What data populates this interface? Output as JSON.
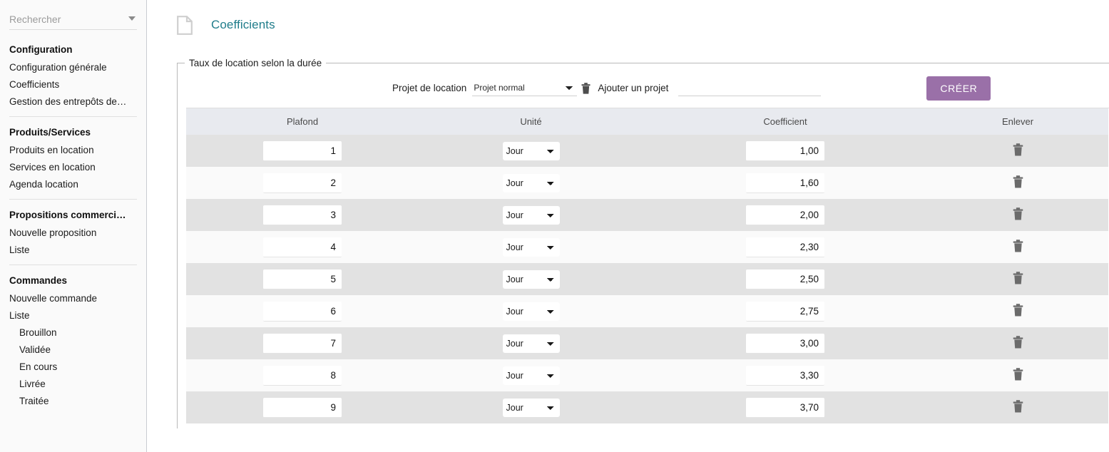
{
  "sidebar": {
    "search": {
      "placeholder": "Rechercher",
      "value": ""
    },
    "groups": [
      {
        "title": "Configuration",
        "items": [
          {
            "label": "Configuration générale",
            "sub": false
          },
          {
            "label": "Coefficients",
            "sub": false
          },
          {
            "label": "Gestion des entrepôts de…",
            "sub": false
          }
        ]
      },
      {
        "title": "Produits/Services",
        "items": [
          {
            "label": "Produits en location",
            "sub": false
          },
          {
            "label": "Services en location",
            "sub": false
          },
          {
            "label": "Agenda location",
            "sub": false
          }
        ]
      },
      {
        "title": "Propositions commerci…",
        "items": [
          {
            "label": "Nouvelle proposition",
            "sub": false
          },
          {
            "label": "Liste",
            "sub": false
          }
        ]
      },
      {
        "title": "Commandes",
        "items": [
          {
            "label": "Nouvelle commande",
            "sub": false
          },
          {
            "label": "Liste",
            "sub": false
          },
          {
            "label": "Brouillon",
            "sub": true
          },
          {
            "label": "Validée",
            "sub": true
          },
          {
            "label": "En cours",
            "sub": true
          },
          {
            "label": "Livrée",
            "sub": true
          },
          {
            "label": "Traitée",
            "sub": true
          }
        ]
      }
    ]
  },
  "header": {
    "icon": "document-icon",
    "title": "Coefficients",
    "title_color": "#217d8b"
  },
  "panel": {
    "legend": "Taux de location selon la durée",
    "project_label": "Projet de location",
    "project_selected": "Projet normal",
    "project_options": [
      "Projet normal"
    ],
    "delete_project_icon": "trash-icon",
    "add_label": "Ajouter un projet",
    "add_placeholder": "",
    "add_value": "",
    "create_label": "CRÉER",
    "create_color": "#9a70a8"
  },
  "table": {
    "columns": [
      "Plafond",
      "Unité",
      "Coefficient",
      "Enlever"
    ],
    "unit_options": [
      "Jour"
    ],
    "row_delete_icon": "trash-icon",
    "rows": [
      {
        "plafond": "1",
        "unite": "Jour",
        "coefficient": "1,00"
      },
      {
        "plafond": "2",
        "unite": "Jour",
        "coefficient": "1,60"
      },
      {
        "plafond": "3",
        "unite": "Jour",
        "coefficient": "2,00"
      },
      {
        "plafond": "4",
        "unite": "Jour",
        "coefficient": "2,30"
      },
      {
        "plafond": "5",
        "unite": "Jour",
        "coefficient": "2,50"
      },
      {
        "plafond": "6",
        "unite": "Jour",
        "coefficient": "2,75"
      },
      {
        "plafond": "7",
        "unite": "Jour",
        "coefficient": "3,00"
      },
      {
        "plafond": "8",
        "unite": "Jour",
        "coefficient": "3,30"
      },
      {
        "plafond": "9",
        "unite": "Jour",
        "coefficient": "3,70"
      }
    ]
  }
}
